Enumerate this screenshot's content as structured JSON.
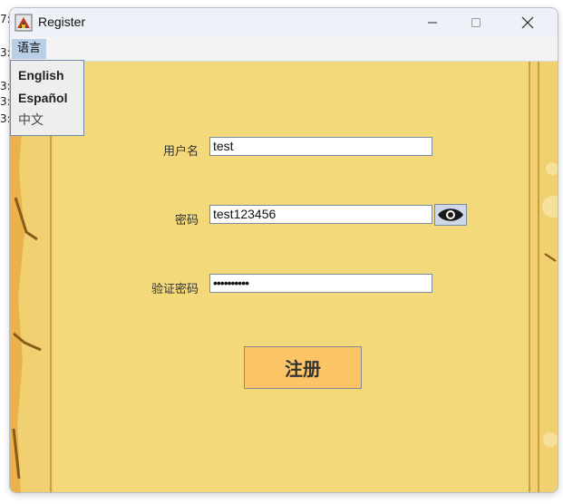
{
  "background_fragments": [
    "7:",
    "3:",
    "3:",
    "3:",
    "3:"
  ],
  "window": {
    "title": "Register",
    "controls": [
      "minimize-icon",
      "maximize-icon",
      "close-icon"
    ]
  },
  "menubar": {
    "menu_label": "语言"
  },
  "language_menu": {
    "items": [
      {
        "label": "English"
      },
      {
        "label": "Español"
      },
      {
        "label": "中文"
      }
    ]
  },
  "form": {
    "username_label": "用户名",
    "username_value": "test",
    "password_label": "密码",
    "password_value": "test123456",
    "confirm_label": "验证密码",
    "confirm_value": "••••••••••",
    "submit_label": "注册"
  },
  "colors": {
    "panel_background": "#f3d97a",
    "button_background": "#fbc567",
    "menu_highlight": "#b8cfe5"
  }
}
